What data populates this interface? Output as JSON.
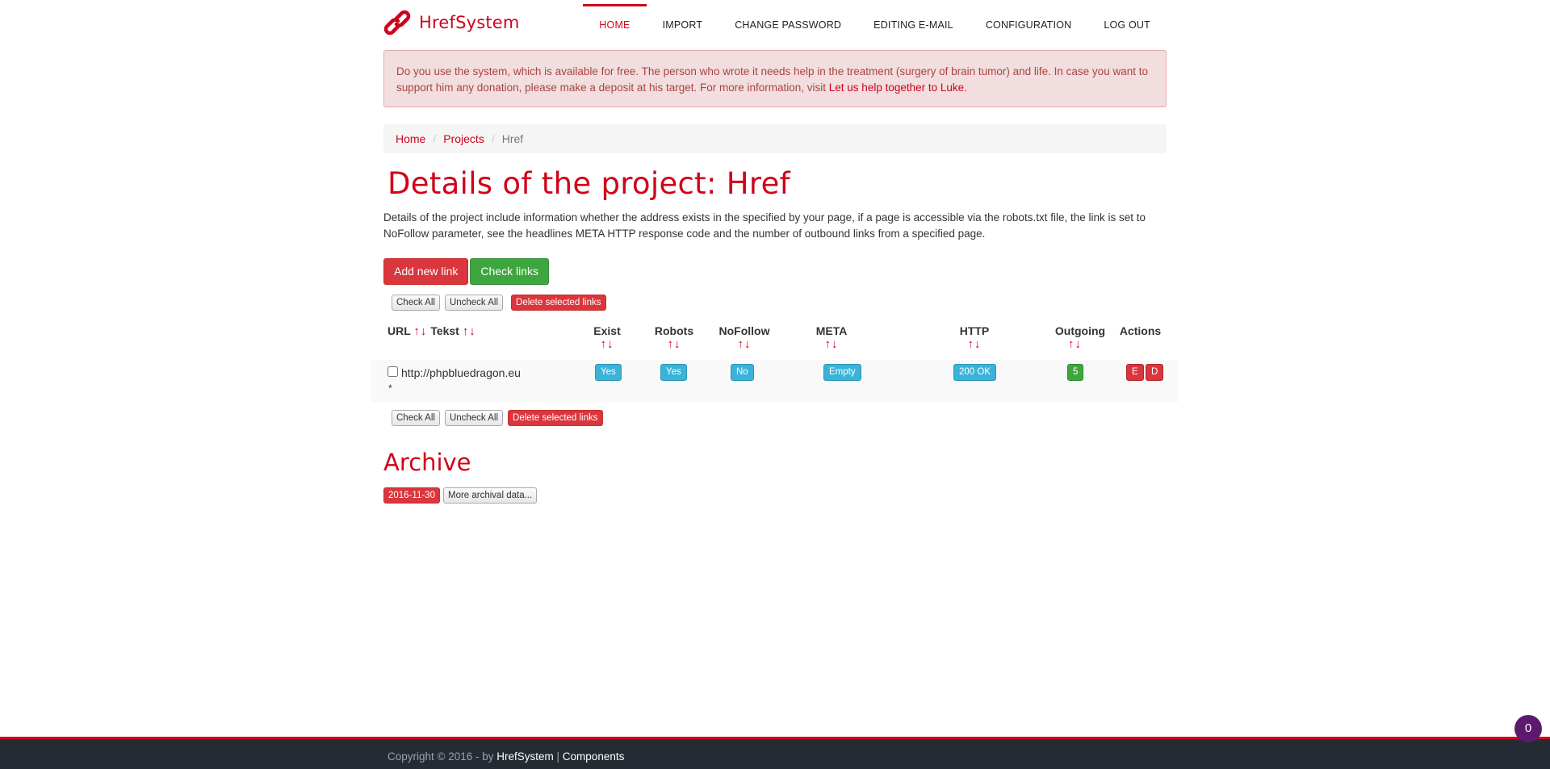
{
  "brand": {
    "name": "HrefSystem",
    "icon": "chain-link-icon",
    "color": "#d0021b"
  },
  "nav": {
    "items": [
      {
        "label": "HOME",
        "active": true
      },
      {
        "label": "IMPORT",
        "active": false
      },
      {
        "label": "CHANGE PASSWORD",
        "active": false
      },
      {
        "label": "EDITING E-MAIL",
        "active": false
      },
      {
        "label": "CONFIGURATION",
        "active": false
      },
      {
        "label": "LOG OUT",
        "active": false
      }
    ]
  },
  "alert": {
    "text": "Do you use the system, which is available for free. The person who wrote it needs help in the treatment (surgery of brain tumor) and life. In case you want to support him any donation, please make a deposit at his target. For more information, visit ",
    "link": "Let us help together to Luke",
    "end": "."
  },
  "breadcrumb": {
    "home": "Home",
    "projects": "Projects",
    "current": "Href",
    "separator": "/"
  },
  "page": {
    "title": "Details of the project: Href",
    "description": "Details of the project include information whether the address exists in the specified by your page, if a page is accessible via the robots.txt file, the link is set to NoFollow parameter, see the headlines META HTTP response code and the number of outbound links from a specified page."
  },
  "actions": {
    "add_new_link": "Add new link",
    "check_links": "Check links"
  },
  "selection": {
    "check_all": "Check All",
    "uncheck_all": "Uncheck All",
    "delete_selected": "Delete selected links"
  },
  "table": {
    "headers": {
      "url": "URL",
      "tekst": "Tekst",
      "exist": "Exist",
      "robots": "Robots",
      "nofollow": "NoFollow",
      "meta": "META",
      "http": "HTTP",
      "outgoing": "Outgoing",
      "actions": "Actions"
    },
    "sort_arrows": "↑↓",
    "rows": [
      {
        "url": "http://phpbluedragon.eu",
        "tekst": "*",
        "exist": "Yes",
        "robots": "Yes",
        "nofollow": "No",
        "meta": "Empty",
        "http": "200 OK",
        "outgoing": "5",
        "edit": "E",
        "delete": "D"
      }
    ]
  },
  "archive": {
    "title": "Archive",
    "date": "2016-11-30",
    "more": "More archival data..."
  },
  "footer": {
    "copyright": "Copyright © 2016 - by ",
    "link1": "HrefSystem",
    "sep": " | ",
    "link2": "Components"
  },
  "notification_badge": "0"
}
